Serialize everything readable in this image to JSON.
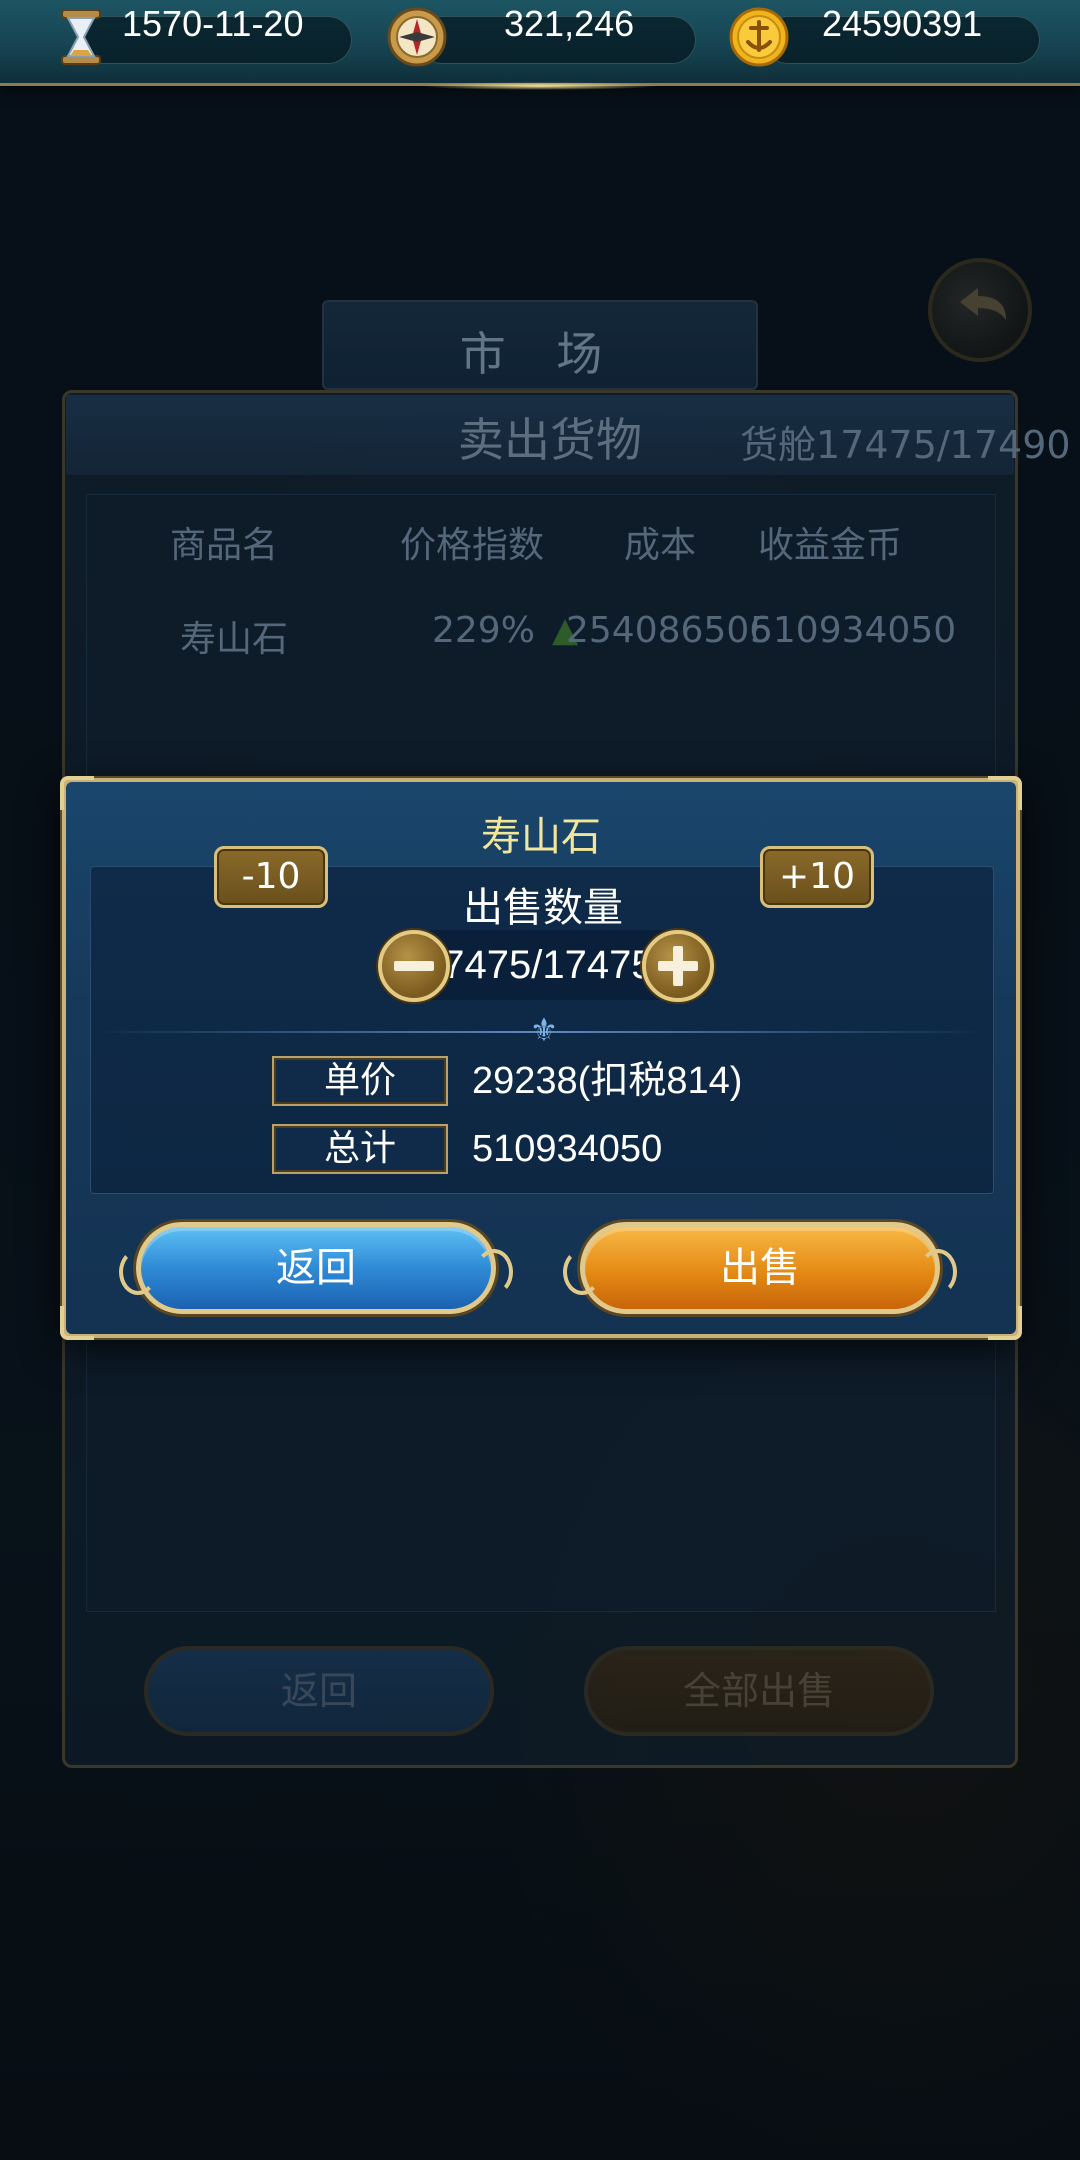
{
  "topbar": {
    "date": "1570-11-20",
    "compass_value": "321,246",
    "gold_value": "24590391",
    "icons": [
      "hourglass-icon",
      "compass-icon",
      "gold-coin-icon"
    ]
  },
  "background_panel": {
    "market_title": "市 场",
    "title": "卖出货物",
    "capacity": "货舱17475/17490",
    "columns": [
      "商品名",
      "价格指数",
      "成本",
      "收益金币"
    ],
    "rows": [
      {
        "name": "寿山石",
        "price_index": "229%",
        "cost": "254086506",
        "revenue": "510934050"
      }
    ],
    "back_label": "返回",
    "sell_all_label": "全部出售"
  },
  "dialog": {
    "title": "寿山石",
    "quantity_label": "出售数量",
    "minus10_label": "-10",
    "plus10_label": "+10",
    "quantity_value": "17475/17475",
    "unit_price_label": "单价",
    "unit_price_value": "29238(扣税814)",
    "total_label": "总计",
    "total_value": "510934050",
    "back_label": "返回",
    "sell_label": "出售"
  },
  "colors": {
    "title_gold": "#f2e69a",
    "frame_gold": "#c8b27a",
    "dialog_blue": "#16395a",
    "btn_blue": "#2f8ad6",
    "btn_orange": "#e48a14"
  }
}
